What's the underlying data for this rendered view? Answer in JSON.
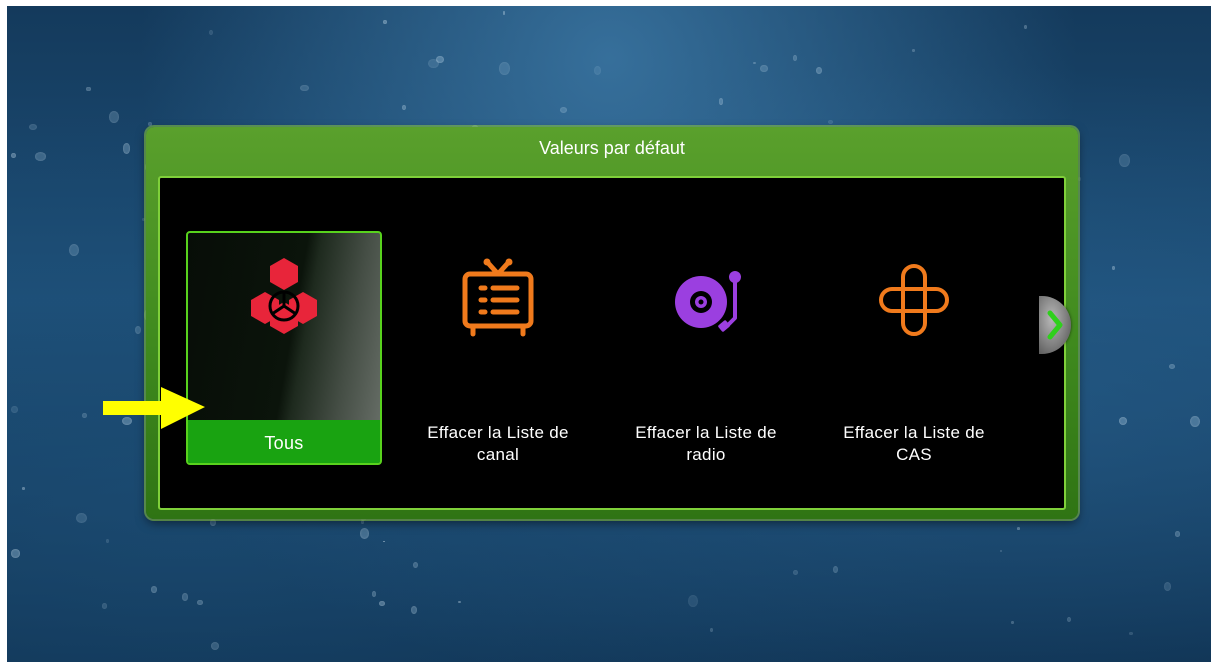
{
  "dialog": {
    "title": "Valeurs par défaut"
  },
  "items": [
    {
      "label": "Tous",
      "icon": "hexagons-icon",
      "selected": true
    },
    {
      "label": "Effacer la Liste de\ncanal",
      "icon": "tv-list-icon",
      "selected": false
    },
    {
      "label": "Effacer la Liste de\nradio",
      "icon": "record-player-icon",
      "selected": false
    },
    {
      "label": "Effacer la Liste de\nCAS",
      "icon": "cas-key-icon",
      "selected": false
    }
  ],
  "colors": {
    "dialog_frame": "#4a9324",
    "selection_border": "#58d21d",
    "selection_bar": "#19a311",
    "tv_icon": "#f07a1c",
    "radio_icon": "#9b3fe0",
    "cas_icon": "#f07a1c",
    "all_icon": "#e8253a",
    "pointer": "#ffff00"
  }
}
